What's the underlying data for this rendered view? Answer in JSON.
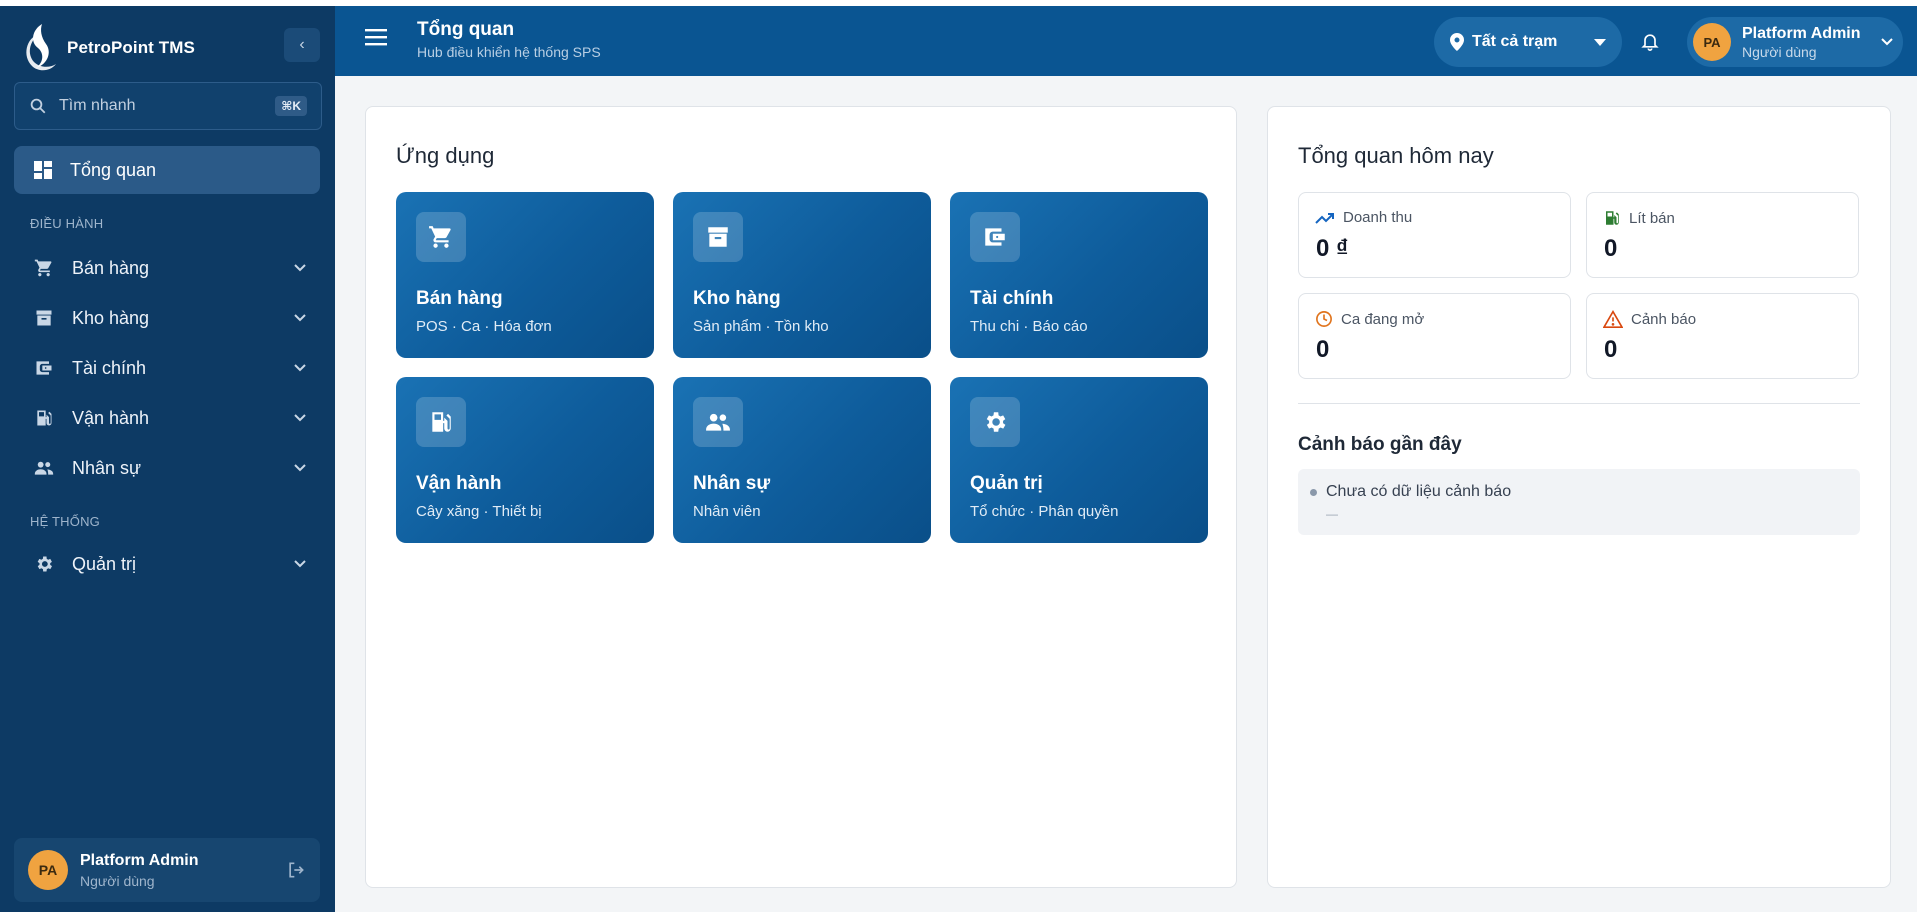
{
  "app": {
    "brand": "PetroPoint TMS"
  },
  "sidebar": {
    "search": {
      "placeholder": "Tìm nhanh",
      "shortcut": "⌘K"
    },
    "active_item": {
      "label": "Tổng quan",
      "icon": "dashboard-icon"
    },
    "sections": [
      {
        "label": "ĐIỀU HÀNH"
      },
      {
        "label": "HỆ THỐNG"
      }
    ],
    "items": [
      {
        "label": "Bán hàng",
        "icon": "cart-icon"
      },
      {
        "label": "Kho hàng",
        "icon": "archive-icon"
      },
      {
        "label": "Tài chính",
        "icon": "wallet-icon"
      },
      {
        "label": "Vận hành",
        "icon": "fuel-pump-icon"
      },
      {
        "label": "Nhân sự",
        "icon": "people-icon"
      },
      {
        "label": "Quản trị",
        "icon": "gear-icon"
      }
    ],
    "user": {
      "initials": "PA",
      "name": "Platform Admin",
      "role": "Người dùng"
    }
  },
  "header": {
    "title": "Tổng quan",
    "subtitle": "Hub điều khiển hệ thống SPS",
    "station_selector": {
      "value": "Tất cả trạm"
    },
    "user": {
      "initials": "PA",
      "name": "Platform Admin",
      "role": "Người dùng"
    }
  },
  "apps": {
    "title": "Ứng dụng",
    "tiles": [
      {
        "name": "Bán hàng",
        "desc": "POS · Ca · Hóa đơn",
        "icon": "cart-icon"
      },
      {
        "name": "Kho hàng",
        "desc": "Sản phẩm · Tồn kho",
        "icon": "archive-icon"
      },
      {
        "name": "Tài chính",
        "desc": "Thu chi · Báo cáo",
        "icon": "wallet-icon"
      },
      {
        "name": "Vận hành",
        "desc": "Cây xăng · Thiết bị",
        "icon": "fuel-pump-icon"
      },
      {
        "name": "Nhân sự",
        "desc": "Nhân viên",
        "icon": "people-icon"
      },
      {
        "name": "Quản trị",
        "desc": "Tổ chức · Phân quyền",
        "icon": "gear-icon"
      }
    ]
  },
  "overview": {
    "title": "Tổng quan hôm nay",
    "stats": [
      {
        "label": "Doanh thu",
        "value": "0 ₫",
        "icon": "trending-up-icon",
        "color": "#1565c0"
      },
      {
        "label": "Lít bán",
        "value": "0",
        "icon": "fuel-pump-icon",
        "color": "#2e7d32"
      },
      {
        "label": "Ca đang mở",
        "value": "0",
        "icon": "clock-icon",
        "color": "#e0741d"
      },
      {
        "label": "Cảnh báo",
        "value": "0",
        "icon": "warning-icon",
        "color": "#d9480f"
      }
    ],
    "recent_alerts": {
      "title": "Cảnh báo gần đây",
      "items": [
        {
          "text": "Chưa có dữ liệu cảnh báo",
          "meta": "—"
        }
      ]
    }
  },
  "colors": {
    "sidebar_bg": "#0d3a64",
    "header_bg": "#0a5592",
    "tile_bg": "#0e5c9b",
    "avatar_bg": "#f0a340",
    "page_bg": "#f3f5f7"
  }
}
